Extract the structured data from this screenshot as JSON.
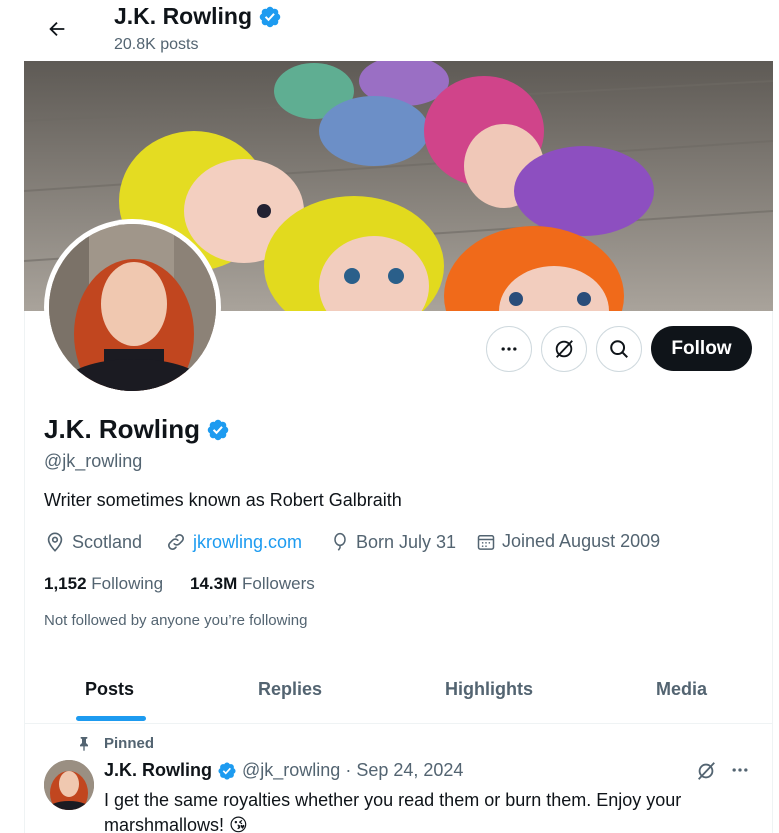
{
  "header": {
    "name": "J.K. Rowling",
    "post_count": "20.8K posts"
  },
  "profile": {
    "name": "J.K. Rowling",
    "handle": "@jk_rowling",
    "bio": "Writer sometimes known as Robert Galbraith",
    "location": "Scotland",
    "website": "jkrowling.com",
    "birthday": "Born July 31",
    "joined": "Joined August 2009",
    "following_count": "1,152",
    "following_label": "Following",
    "followers_count": "14.3M",
    "followers_label": "Followers",
    "not_followed": "Not followed by anyone you’re following",
    "follow_label": "Follow"
  },
  "tabs": [
    {
      "label": "Posts",
      "active": true
    },
    {
      "label": "Replies",
      "active": false
    },
    {
      "label": "Highlights",
      "active": false
    },
    {
      "label": "Media",
      "active": false
    }
  ],
  "pinned_post": {
    "pinned_label": "Pinned",
    "author": "J.K. Rowling",
    "handle": "@jk_rowling",
    "separator": "·",
    "date": "Sep 24, 2024",
    "text": "I get the same royalties whether you read them or burn them. Enjoy your marshmallows! 😘"
  },
  "colors": {
    "accent": "#1d9bf0",
    "text": "#0f1419",
    "secondary": "#536471",
    "follow_bg": "#0f1419"
  },
  "icons": {
    "back": "arrow-left-icon",
    "verified": "verified-badge-icon",
    "more": "more-icon",
    "grok": "grok-icon",
    "search": "search-icon",
    "location": "location-icon",
    "link": "link-icon",
    "birthday": "balloon-icon",
    "calendar": "calendar-icon",
    "pin": "pin-icon"
  }
}
